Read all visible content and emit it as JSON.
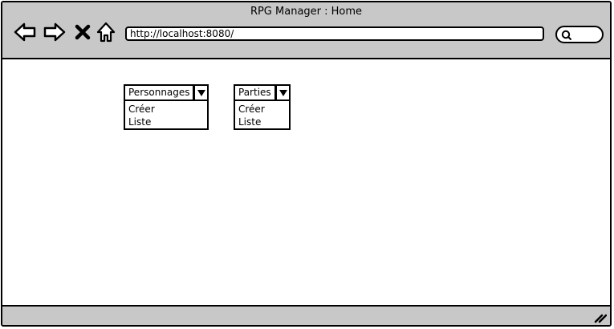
{
  "window": {
    "title": "RPG Manager : Home"
  },
  "toolbar": {
    "back_icon": "arrow-left-icon",
    "forward_icon": "arrow-right-icon",
    "stop_icon": "close-icon",
    "home_icon": "home-icon",
    "url": "http://localhost:8080/",
    "search_icon": "search-icon"
  },
  "menus": [
    {
      "label": "Personnages",
      "items": [
        "Créer",
        "Liste"
      ]
    },
    {
      "label": "Parties",
      "items": [
        "Créer",
        "Liste"
      ]
    }
  ],
  "colors": {
    "chrome": "#c8c8c8",
    "border": "#000000",
    "background": "#ffffff"
  }
}
